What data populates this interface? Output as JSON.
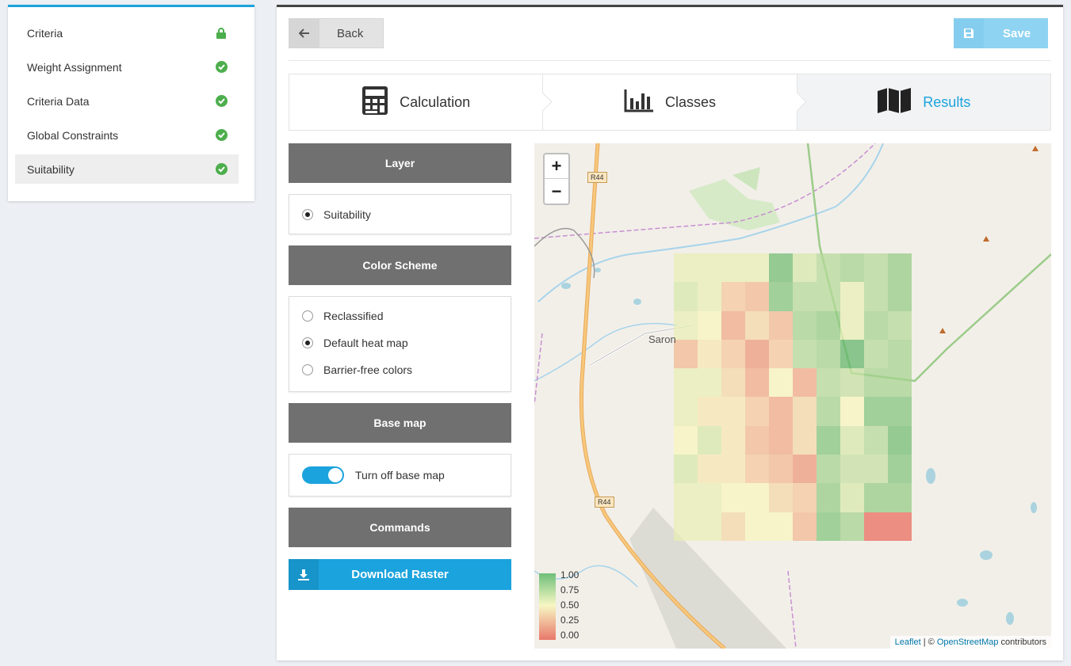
{
  "sidebar": {
    "items": [
      {
        "label": "Criteria",
        "icon": "lock-icon"
      },
      {
        "label": "Weight Assignment",
        "icon": "check-circle-icon"
      },
      {
        "label": "Criteria Data",
        "icon": "check-circle-icon"
      },
      {
        "label": "Global Constraints",
        "icon": "check-circle-icon"
      },
      {
        "label": "Suitability",
        "icon": "check-circle-icon",
        "active": true
      }
    ]
  },
  "toolbar": {
    "back_label": "Back",
    "save_label": "Save"
  },
  "steps": [
    {
      "label": "Calculation",
      "icon": "calculator-icon"
    },
    {
      "label": "Classes",
      "icon": "bar-chart-icon"
    },
    {
      "label": "Results",
      "icon": "map-icon",
      "active": true
    }
  ],
  "panel": {
    "layer_header": "Layer",
    "layer_option": "Suitability",
    "color_header": "Color Scheme",
    "color_options": [
      "Reclassified",
      "Default heat map",
      "Barrier-free colors"
    ],
    "color_selected": "Default heat map",
    "basemap_header": "Base map",
    "basemap_toggle_label": "Turn off base map",
    "basemap_toggle_on": true,
    "commands_header": "Commands",
    "download_label": "Download Raster"
  },
  "map": {
    "zoom_in": "+",
    "zoom_out": "−",
    "town_label": "Saron",
    "road_label": "R44",
    "legend_ticks": [
      "1.00",
      "0.75",
      "0.50",
      "0.25",
      "0.00"
    ],
    "attribution": {
      "leaflet": "Leaflet",
      "sep": " | © ",
      "osm": "OpenStreetMap",
      "suffix": " contributors"
    },
    "suitability_grid": [
      [
        0.55,
        0.55,
        0.55,
        0.55,
        0.9,
        0.6,
        0.7,
        0.75,
        0.7,
        0.8
      ],
      [
        0.6,
        0.55,
        0.35,
        0.3,
        0.85,
        0.7,
        0.7,
        0.55,
        0.7,
        0.8
      ],
      [
        0.55,
        0.5,
        0.25,
        0.4,
        0.3,
        0.75,
        0.8,
        0.55,
        0.75,
        0.7
      ],
      [
        0.3,
        0.45,
        0.35,
        0.2,
        0.35,
        0.7,
        0.75,
        0.95,
        0.7,
        0.75
      ],
      [
        0.55,
        0.55,
        0.4,
        0.25,
        0.5,
        0.25,
        0.7,
        0.65,
        0.75,
        0.75
      ],
      [
        0.55,
        0.45,
        0.45,
        0.35,
        0.25,
        0.4,
        0.75,
        0.5,
        0.85,
        0.85
      ],
      [
        0.5,
        0.6,
        0.45,
        0.3,
        0.25,
        0.4,
        0.85,
        0.6,
        0.7,
        0.9
      ],
      [
        0.6,
        0.45,
        0.45,
        0.35,
        0.3,
        0.2,
        0.75,
        0.65,
        0.65,
        0.85
      ],
      [
        0.55,
        0.55,
        0.5,
        0.5,
        0.4,
        0.35,
        0.8,
        0.6,
        0.8,
        0.8
      ],
      [
        0.55,
        0.55,
        0.4,
        0.5,
        0.5,
        0.3,
        0.85,
        0.75,
        0.05,
        0.05
      ]
    ]
  },
  "colors": {
    "accent": "#1ba3dd",
    "success": "#4cae4c",
    "header_bg": "#707070"
  }
}
